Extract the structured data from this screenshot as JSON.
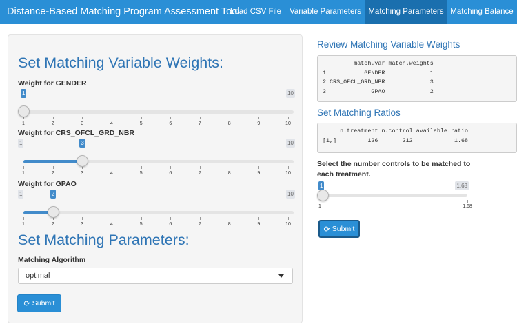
{
  "navbar": {
    "brand": "Distance-Based Matching Program Assessment Tool",
    "tabs": [
      "Load CSV File",
      "Variable Parameters",
      "Matching Parameters",
      "Matching Balance"
    ],
    "active_tab": "Matching Parameters",
    "bg_color": "#2a8fd6",
    "active_color": "#1a6fae"
  },
  "left": {
    "weights_heading": "Set Matching Variable Weights:",
    "sliders": [
      {
        "label": "Weight for GENDER",
        "value": 1,
        "min": 1,
        "max": 10,
        "ticks": [
          "1",
          "2",
          "3",
          "4",
          "5",
          "6",
          "7",
          "8",
          "9",
          "10"
        ],
        "value_text": "1",
        "min_text": "1",
        "max_text": "10"
      },
      {
        "label": "Weight for CRS_OFCL_GRD_NBR",
        "value": 3,
        "min": 1,
        "max": 10,
        "ticks": [
          "1",
          "2",
          "3",
          "4",
          "5",
          "6",
          "7",
          "8",
          "9",
          "10"
        ],
        "value_text": "3",
        "min_text": "1",
        "max_text": "10"
      },
      {
        "label": "Weight for GPAO",
        "value": 2,
        "min": 1,
        "max": 10,
        "ticks": [
          "1",
          "2",
          "3",
          "4",
          "5",
          "6",
          "7",
          "8",
          "9",
          "10"
        ],
        "value_text": "2",
        "min_text": "1",
        "max_text": "10"
      }
    ],
    "params_heading": "Set Matching Parameters:",
    "algorithm_label": "Matching Algorithm",
    "algorithm_value": "optimal",
    "submit_label": "Submit"
  },
  "right": {
    "review_heading": "Review Matching Variable Weights",
    "weights_table": "         match.var match.weights\n1           GENDER             1\n2 CRS_OFCL_GRD_NBR             3\n3             GPAO             2",
    "ratios_heading": "Set Matching Ratios",
    "ratios_table": "     n.treatment n.control available.ratio\n[1,]         126       212            1.68",
    "controls_label": "Select the number controls to be matched to each treatment.",
    "ratio_slider": {
      "value": 1,
      "min": 1,
      "max": 1.68,
      "value_text": "1",
      "max_text": "1.68",
      "min_tick": "1",
      "max_tick": "1.68"
    },
    "submit_label": "Submit"
  },
  "colors": {
    "heading": "#2f75b5",
    "accent": "#428bca"
  }
}
